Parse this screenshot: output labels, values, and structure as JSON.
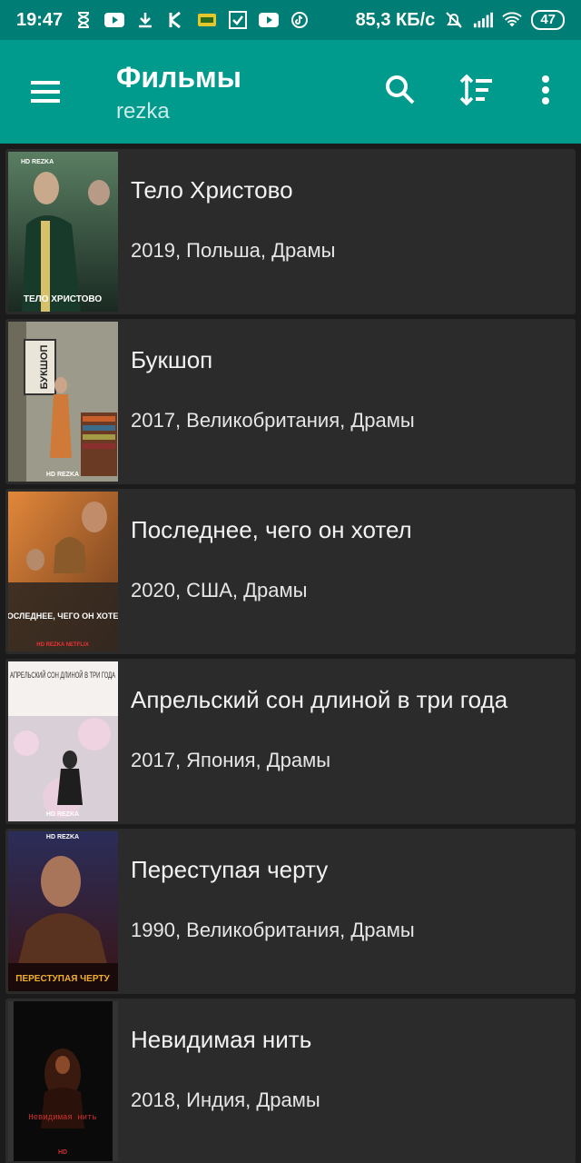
{
  "status": {
    "time": "19:47",
    "network_speed": "85,3 КБ/с",
    "battery": "47"
  },
  "toolbar": {
    "title": "Фильмы",
    "subtitle": "rezka"
  },
  "movies": [
    {
      "title": "Тело Христово",
      "meta": "2019, Польша, Драмы",
      "poster_text": "ТЕЛО ХРИСТОВО",
      "poster_badge": "HD REZKA"
    },
    {
      "title": "Букшоп",
      "meta": "2017, Великобритания, Драмы",
      "poster_text": "БУКШОП",
      "poster_badge": "HD REZKA"
    },
    {
      "title": "Последнее, чего он хотел",
      "meta": "2020, США, Драмы",
      "poster_text": "ПОСЛЕДНЕЕ, ЧЕГО ОН ХОТЕЛ",
      "poster_badge": "HD REZKA NETFLIX"
    },
    {
      "title": "Апрельский сон длиной в три года",
      "meta": "2017, Япония, Драмы",
      "poster_text": "АПРЕЛЬСКИЙ СОН ДЛИНОЙ В ТРИ ГОДА",
      "poster_badge": "HD REZKA"
    },
    {
      "title": "Переступая черту",
      "meta": "1990, Великобритания, Драмы",
      "poster_text": "ПЕРЕСТУПАЯ ЧЕРТУ",
      "poster_badge": "HD REZKA"
    },
    {
      "title": "Невидимая нить",
      "meta": "2018, Индия, Драмы",
      "poster_text": "Невидимая нить",
      "poster_badge": "HD"
    }
  ],
  "colors": {
    "statusbar": "#007d74",
    "toolbar": "#009b8d",
    "card": "#2b2b2b",
    "background": "#1b1b1b"
  }
}
